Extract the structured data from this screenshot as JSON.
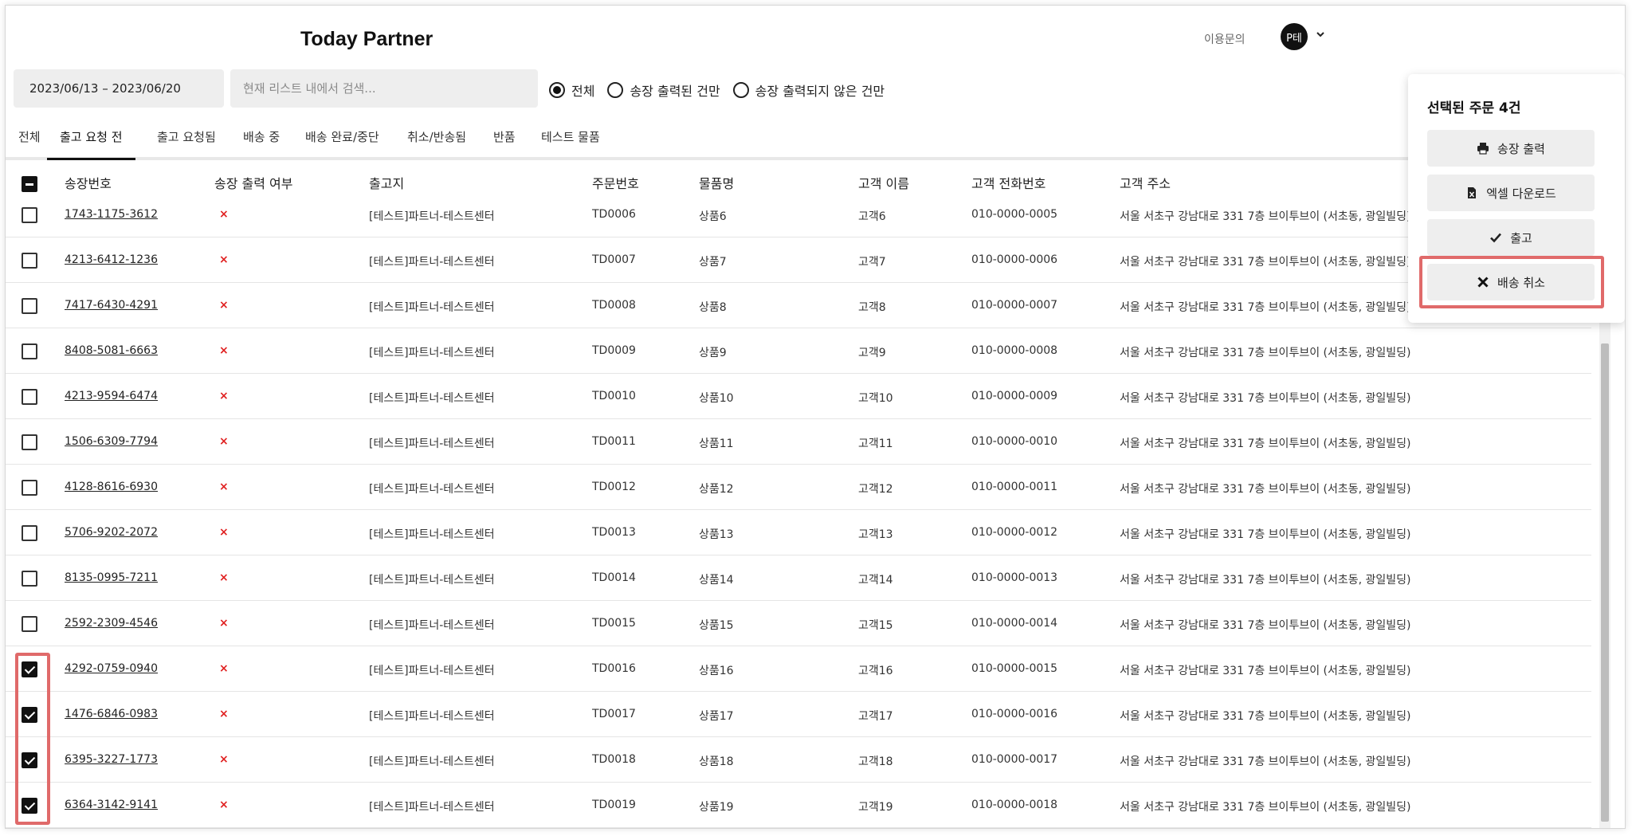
{
  "header": {
    "logo": "Today Partner",
    "inquiry": "이용문의",
    "avatar_text": "P테",
    "caret": "⌄"
  },
  "filter": {
    "date_range": "2023/06/13 – 2023/06/20",
    "search_placeholder": "현재 리스트 내에서 검색...",
    "radios": [
      {
        "label": "전체",
        "selected": true
      },
      {
        "label": "송장 출력된 건만",
        "selected": false
      },
      {
        "label": "송장 출력되지 않은 건만",
        "selected": false
      }
    ]
  },
  "tabs": [
    {
      "label": "전체",
      "active": false
    },
    {
      "label": "출고 요청 전",
      "active": true
    },
    {
      "label": "출고 요청됨",
      "active": false
    },
    {
      "label": "배송 중",
      "active": false
    },
    {
      "label": "배송 완료/중단",
      "active": false
    },
    {
      "label": "취소/반송됨",
      "active": false
    },
    {
      "label": "반품",
      "active": false
    },
    {
      "label": "테스트 물품",
      "active": false
    }
  ],
  "table": {
    "headers": [
      "송장번호",
      "송장 출력 여부",
      "출고지",
      "주문번호",
      "물품명",
      "고객 이름",
      "고객 전화번호",
      "고객 주소"
    ],
    "rows": [
      {
        "checked": false,
        "invoice": "1743-1175-3612",
        "printed": "×",
        "origin": "[테스트]파트너-테스트센터",
        "order": "TD0006",
        "item": "상품6",
        "name": "고객6",
        "phone": "010-0000-0005",
        "address": "서울 서초구 강남대로 331 7층 브이투브이 (서초동, 광일빌딩)"
      },
      {
        "checked": false,
        "invoice": "4213-6412-1236",
        "printed": "×",
        "origin": "[테스트]파트너-테스트센터",
        "order": "TD0007",
        "item": "상품7",
        "name": "고객7",
        "phone": "010-0000-0006",
        "address": "서울 서초구 강남대로 331 7층 브이투브이 (서초동, 광일빌딩)"
      },
      {
        "checked": false,
        "invoice": "7417-6430-4291",
        "printed": "×",
        "origin": "[테스트]파트너-테스트센터",
        "order": "TD0008",
        "item": "상품8",
        "name": "고객8",
        "phone": "010-0000-0007",
        "address": "서울 서초구 강남대로 331 7층 브이투브이 (서초동, 광일빌딩)"
      },
      {
        "checked": false,
        "invoice": "8408-5081-6663",
        "printed": "×",
        "origin": "[테스트]파트너-테스트센터",
        "order": "TD0009",
        "item": "상품9",
        "name": "고객9",
        "phone": "010-0000-0008",
        "address": "서울 서초구 강남대로 331 7층 브이투브이 (서초동, 광일빌딩)"
      },
      {
        "checked": false,
        "invoice": "4213-9594-6474",
        "printed": "×",
        "origin": "[테스트]파트너-테스트센터",
        "order": "TD0010",
        "item": "상품10",
        "name": "고객10",
        "phone": "010-0000-0009",
        "address": "서울 서초구 강남대로 331 7층 브이투브이 (서초동, 광일빌딩)"
      },
      {
        "checked": false,
        "invoice": "1506-6309-7794",
        "printed": "×",
        "origin": "[테스트]파트너-테스트센터",
        "order": "TD0011",
        "item": "상품11",
        "name": "고객11",
        "phone": "010-0000-0010",
        "address": "서울 서초구 강남대로 331 7층 브이투브이 (서초동, 광일빌딩)"
      },
      {
        "checked": false,
        "invoice": "4128-8616-6930",
        "printed": "×",
        "origin": "[테스트]파트너-테스트센터",
        "order": "TD0012",
        "item": "상품12",
        "name": "고객12",
        "phone": "010-0000-0011",
        "address": "서울 서초구 강남대로 331 7층 브이투브이 (서초동, 광일빌딩)"
      },
      {
        "checked": false,
        "invoice": "5706-9202-2072",
        "printed": "×",
        "origin": "[테스트]파트너-테스트센터",
        "order": "TD0013",
        "item": "상품13",
        "name": "고객13",
        "phone": "010-0000-0012",
        "address": "서울 서초구 강남대로 331 7층 브이투브이 (서초동, 광일빌딩)"
      },
      {
        "checked": false,
        "invoice": "8135-0995-7211",
        "printed": "×",
        "origin": "[테스트]파트너-테스트센터",
        "order": "TD0014",
        "item": "상품14",
        "name": "고객14",
        "phone": "010-0000-0013",
        "address": "서울 서초구 강남대로 331 7층 브이투브이 (서초동, 광일빌딩)"
      },
      {
        "checked": false,
        "invoice": "2592-2309-4546",
        "printed": "×",
        "origin": "[테스트]파트너-테스트센터",
        "order": "TD0015",
        "item": "상품15",
        "name": "고객15",
        "phone": "010-0000-0014",
        "address": "서울 서초구 강남대로 331 7층 브이투브이 (서초동, 광일빌딩)"
      },
      {
        "checked": true,
        "invoice": "4292-0759-0940",
        "printed": "×",
        "origin": "[테스트]파트너-테스트센터",
        "order": "TD0016",
        "item": "상품16",
        "name": "고객16",
        "phone": "010-0000-0015",
        "address": "서울 서초구 강남대로 331 7층 브이투브이 (서초동, 광일빌딩)"
      },
      {
        "checked": true,
        "invoice": "1476-6846-0983",
        "printed": "×",
        "origin": "[테스트]파트너-테스트센터",
        "order": "TD0017",
        "item": "상품17",
        "name": "고객17",
        "phone": "010-0000-0016",
        "address": "서울 서초구 강남대로 331 7층 브이투브이 (서초동, 광일빌딩)"
      },
      {
        "checked": true,
        "invoice": "6395-3227-1773",
        "printed": "×",
        "origin": "[테스트]파트너-테스트센터",
        "order": "TD0018",
        "item": "상품18",
        "name": "고객18",
        "phone": "010-0000-0017",
        "address": "서울 서초구 강남대로 331 7층 브이투브이 (서초동, 광일빌딩)"
      },
      {
        "checked": true,
        "invoice": "6364-3142-9141",
        "printed": "×",
        "origin": "[테스트]파트너-테스트센터",
        "order": "TD0019",
        "item": "상품19",
        "name": "고객19",
        "phone": "010-0000-0018",
        "address": "서울 서초구 강남대로 331 7층 브이투브이 (서초동, 광일빌딩)"
      }
    ]
  },
  "panel": {
    "title": "선택된 주문 4건",
    "buttons": [
      {
        "label": "송장 출력",
        "icon": "printer-icon"
      },
      {
        "label": "엑셀 다운로드",
        "icon": "file-excel-icon"
      },
      {
        "label": "출고",
        "icon": "check-icon"
      },
      {
        "label": "배송 취소",
        "icon": "close-icon"
      }
    ]
  },
  "colors": {
    "highlight": "#e06a6a",
    "x_mark": "#e02020",
    "field_bg": "#eeeeee"
  }
}
